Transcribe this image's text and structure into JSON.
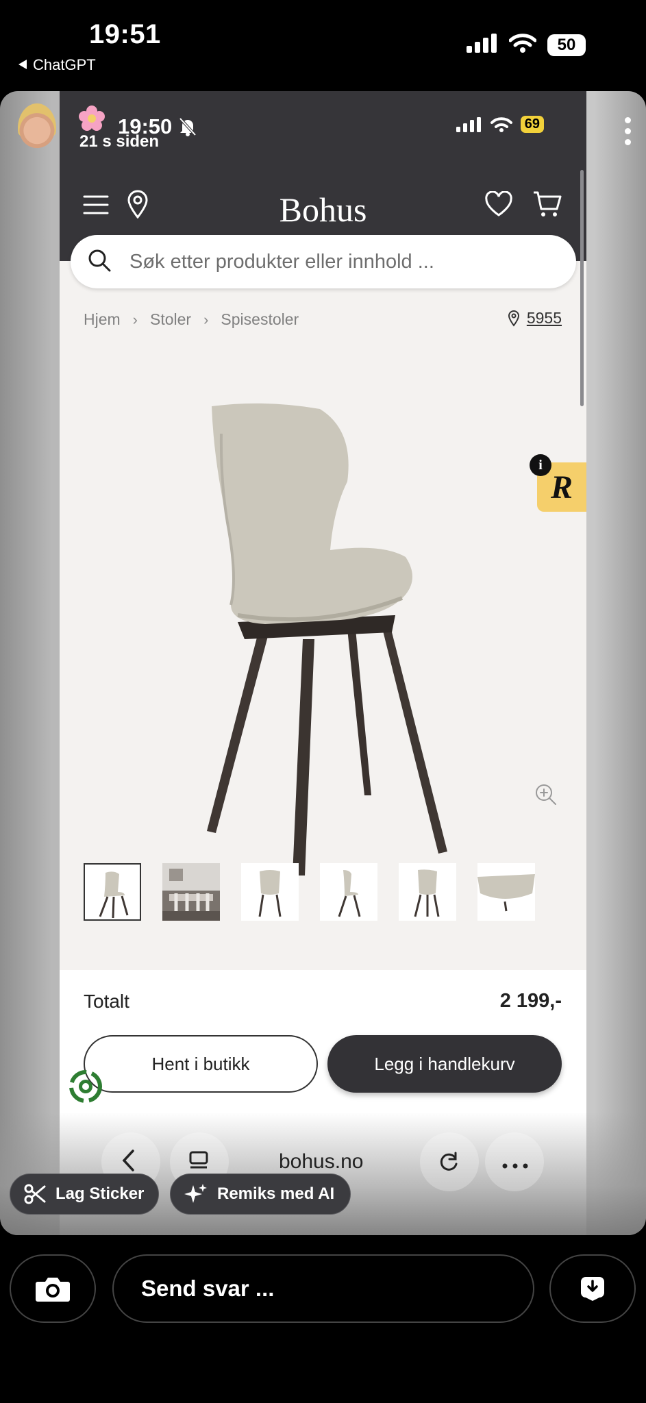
{
  "status_bar": {
    "time": "19:51",
    "back_app": "ChatGPT",
    "battery": "50"
  },
  "story": {
    "inner_time": "19:50",
    "posted_ago": "21 s siden",
    "inner_battery": "69"
  },
  "site": {
    "logo": "Bohus",
    "search_placeholder": "Søk etter produkter eller innhold ...",
    "breadcrumb": [
      "Hjem",
      "Stoler",
      "Spisestoler"
    ],
    "store_number": "5955",
    "total_label": "Totalt",
    "total_price": "2 199,-",
    "pickup_button": "Hent i butikk",
    "cart_button": "Legg i handlekurv",
    "url": "bohus.no"
  },
  "story_actions": {
    "sticker": "Lag Sticker",
    "remix": "Remiks med AI"
  },
  "reply": {
    "placeholder": "Send svar ..."
  },
  "colors": {
    "header_dark": "#363539",
    "cart_button": "#333236",
    "badge_yellow": "#f5cf6b",
    "battery_yellow": "#f2d13a"
  },
  "icons": [
    "menu-icon",
    "location-pin-icon",
    "heart-icon",
    "cart-icon",
    "search-icon",
    "zoom-icon",
    "camera-icon",
    "download-icon",
    "scissors-icon",
    "sparkle-icon",
    "recycle-icon"
  ]
}
